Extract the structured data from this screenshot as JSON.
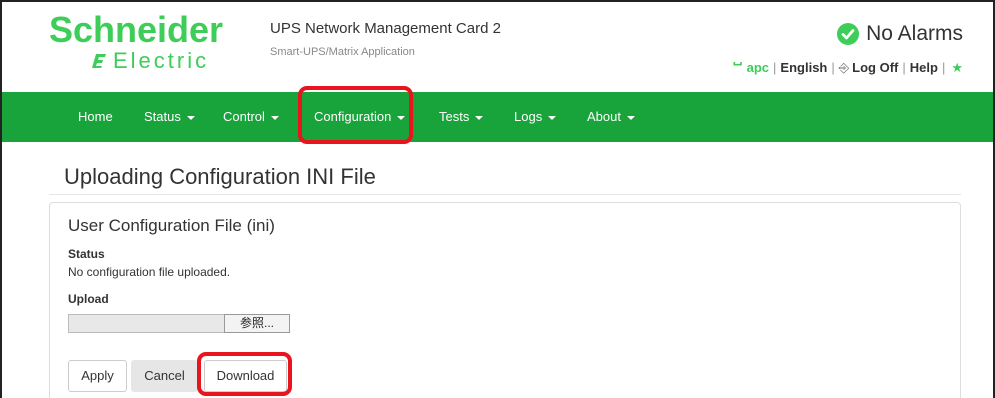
{
  "header": {
    "logo_top": "Schneider",
    "logo_bottom": "Electric",
    "product_title": "UPS Network Management Card 2",
    "product_subtitle": "Smart-UPS/Matrix Application",
    "alarm_status": "No Alarms",
    "user": "apc",
    "language": "English",
    "logoff": "Log Off",
    "help": "Help",
    "colors": {
      "brand_green": "#3dcd58",
      "nav_green": "#19a33b",
      "highlight_red": "#e8141e"
    }
  },
  "nav": {
    "items": [
      "Home",
      "Status",
      "Control",
      "Configuration",
      "Tests",
      "Logs",
      "About"
    ]
  },
  "page": {
    "title": "Uploading Configuration INI File",
    "panel_title": "User Configuration File (ini)",
    "status_label": "Status",
    "status_text": "No configuration file uploaded.",
    "upload_label": "Upload",
    "browse_label": "参照...",
    "buttons": {
      "apply": "Apply",
      "cancel": "Cancel",
      "download": "Download"
    }
  }
}
